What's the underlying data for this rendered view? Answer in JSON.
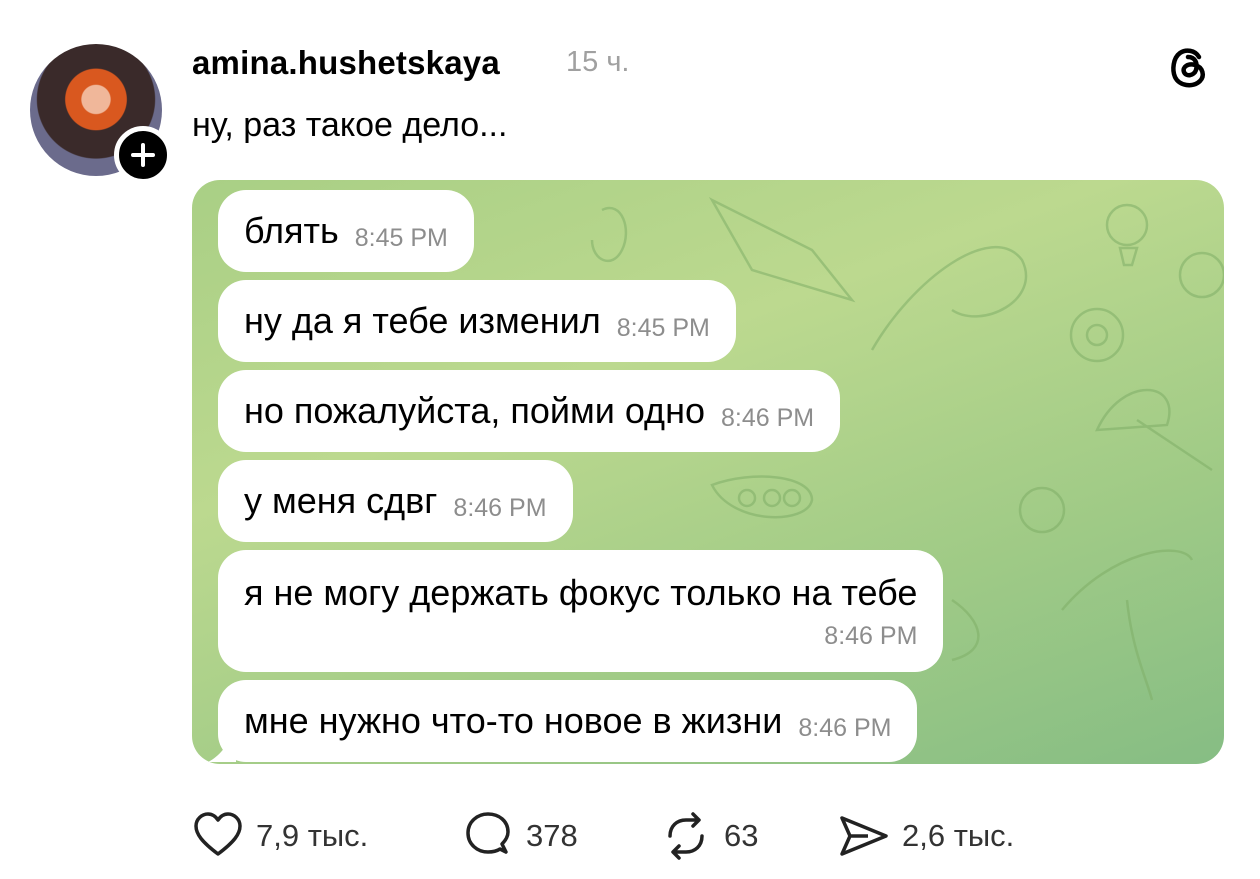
{
  "post": {
    "username": "amina.hushetskaya",
    "time": "15 ч.",
    "caption": "ну, раз такое дело..."
  },
  "chat": {
    "messages": [
      {
        "text": "блять",
        "time": "8:45 PM"
      },
      {
        "text": "ну да я тебе изменил",
        "time": "8:45 PM"
      },
      {
        "text": "но пожалуйста, пойми одно",
        "time": "8:46 PM"
      },
      {
        "text": "у меня сдвг",
        "time": "8:46 PM"
      },
      {
        "text": "я не могу держать фокус только на тебе",
        "time": "8:46 PM"
      },
      {
        "text": "мне нужно что-то новое в жизни",
        "time": "8:46 PM"
      }
    ]
  },
  "actions": {
    "likes": "7,9 тыс.",
    "comments": "378",
    "reposts": "63",
    "shares": "2,6 тыс."
  },
  "icons": {
    "avatar": "avatar",
    "follow": "plus-icon",
    "brand": "threads-logo-icon",
    "like": "heart-icon",
    "comment": "comment-bubble-icon",
    "repost": "repost-icon",
    "share": "share-plane-icon"
  },
  "colors": {
    "chat_background": "#a9cf85",
    "bubble": "#ffffff",
    "timestamp": "#8d8d8d",
    "post_time": "#a0a0a0"
  }
}
